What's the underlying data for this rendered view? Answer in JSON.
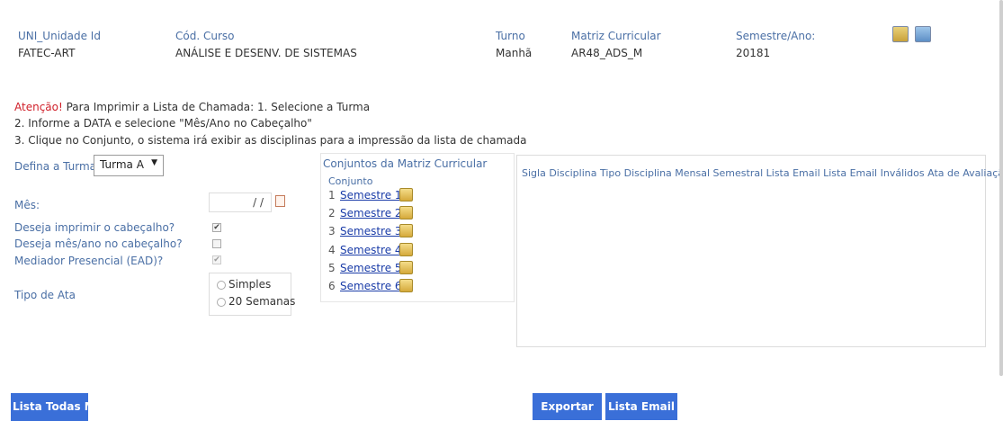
{
  "header": {
    "unidade_label": "UNI_Unidade Id",
    "unidade_value": "FATEC-ART",
    "curso_label": "Cód. Curso",
    "curso_value": "ANÁLISE E DESENV. DE SISTEMAS",
    "turno_label": "Turno",
    "turno_value": "Manhã",
    "matriz_label": "Matriz Curricular",
    "matriz_value": "AR48_ADS_M",
    "semestre_label": "Semestre/Ano:",
    "semestre_value": "20181"
  },
  "instructions": {
    "attention": "Atenção!",
    "line1": " Para Imprimir a Lista de Chamada:  1. Selecione a Turma",
    "line2": "2. Informe a DATA e selecione \"Mês/Ano no Cabeçalho\"",
    "line3": "3. Clique no Conjunto, o sistema irá exibir as disciplinas para a impressão da lista de chamada"
  },
  "form": {
    "turma_label": "Defina a Turma:",
    "turma_value": "Turma A",
    "mes_label": "Mês:",
    "mes_value": "/ /",
    "imprimir_cabecalho_label": "Deseja imprimir o cabeçalho?",
    "mes_ano_label": "Deseja mês/ano no cabeçalho?",
    "mediador_label": "Mediador Presencial (EAD)?",
    "tipo_ata_label": "Tipo de Ata",
    "tipo_ata_options": [
      "Simples",
      "20 Semanas"
    ]
  },
  "conjuntos": {
    "title": "Conjuntos da Matriz Curricular",
    "column": "Conjunto",
    "items": [
      {
        "num": "1",
        "label": "Semestre 1"
      },
      {
        "num": "2",
        "label": "Semestre 2"
      },
      {
        "num": "3",
        "label": "Semestre 3"
      },
      {
        "num": "4",
        "label": "Semestre 4"
      },
      {
        "num": "5",
        "label": "Semestre 5"
      },
      {
        "num": "6",
        "label": "Semestre 6"
      }
    ]
  },
  "disciplinas": {
    "header": "Sigla Disciplina Tipo Disciplina Mensal Semestral Lista Email Lista Email Inválidos Ata de Avaliação"
  },
  "buttons": {
    "lista_todas": "Lista Todas Me",
    "exportar": "Exportar",
    "lista_email": "Lista Email"
  },
  "colors": {
    "button": "#3a6fd8",
    "label_blue": "#4a6fa5",
    "attention_red": "#d0202a",
    "link": "#1a3ca8"
  }
}
